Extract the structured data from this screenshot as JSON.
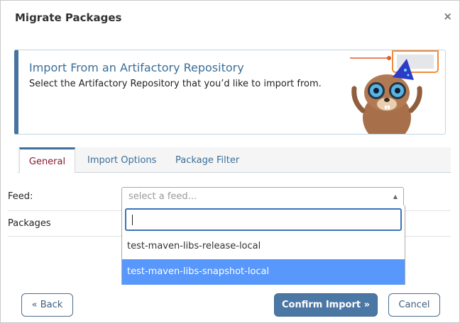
{
  "dialog": {
    "title": "Migrate Packages",
    "close_icon": "close-icon",
    "close_glyph": "×"
  },
  "banner": {
    "title": "Import From an Artifactory Repository",
    "description": "Select the Artifactory Repository that you’d like to import from.",
    "illustration": "mascot-illustration",
    "accent_color": "#49739f"
  },
  "tabs": [
    {
      "label": "General",
      "active": true
    },
    {
      "label": "Import Options",
      "active": false
    },
    {
      "label": "Package Filter",
      "active": false
    }
  ],
  "form": {
    "feed_label": "Feed:",
    "packages_label": "Packages",
    "feed_select": {
      "placeholder": "select a feed...",
      "search_value": "",
      "options": [
        {
          "label": "test-maven-libs-release-local",
          "highlighted": false
        },
        {
          "label": "test-maven-libs-snapshot-local",
          "highlighted": true
        }
      ],
      "arrow_icon": "caret-up-icon"
    }
  },
  "footer": {
    "back_label": "« Back",
    "confirm_label": "Confirm Import »",
    "cancel_label": "Cancel"
  },
  "colors": {
    "link_blue": "#3a6e99",
    "active_tab_text": "#8a1a2e",
    "highlight": "#5897fb",
    "primary_button": "#4b77a4"
  }
}
